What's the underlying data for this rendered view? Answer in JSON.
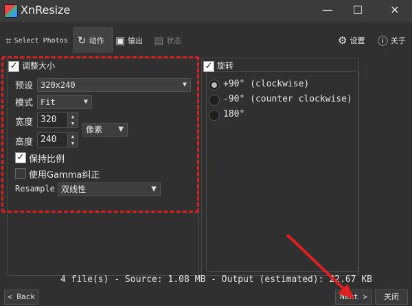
{
  "window": {
    "title": "XnResize"
  },
  "toolbar": {
    "select_photos": "Select Photos",
    "action": "动作",
    "output": "输出",
    "status": "状态",
    "settings": "设置",
    "about": "关于"
  },
  "resize": {
    "group_label": "调整大小",
    "preset_label": "预设",
    "preset_value": "320x240",
    "mode_label": "模式",
    "mode_value": "Fit",
    "width_label": "宽度",
    "width_value": "320",
    "height_label": "高度",
    "height_value": "240",
    "unit_value": "像素",
    "keep_ratio_label": "保持比例",
    "gamma_label": "使用Gamma纠正",
    "resample_label": "Resample",
    "resample_value": "双线性"
  },
  "rotate": {
    "group_label": "旋转",
    "options": [
      {
        "label": "+90°  (clockwise)",
        "selected": true
      },
      {
        "label": "-90°  (counter clockwise)",
        "selected": false
      },
      {
        "label": "180°",
        "selected": false
      }
    ]
  },
  "status": {
    "text": "4 file(s) - Source: 1.08 MB - Output (estimated): 22.67 KB"
  },
  "buttons": {
    "back": "< Back",
    "next": "Next >",
    "close": "关闭"
  },
  "colors": {
    "annotation": "#e02020"
  }
}
